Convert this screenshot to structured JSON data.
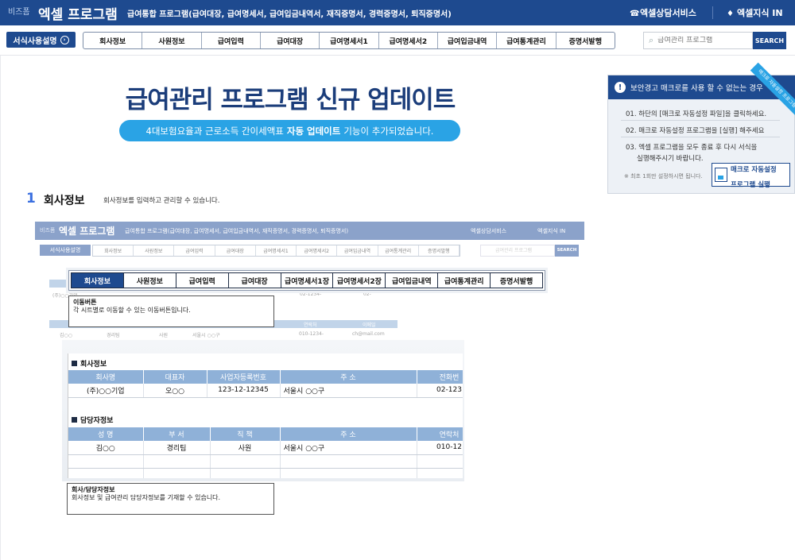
{
  "header": {
    "brand_small": "비즈폼",
    "brand_name": "엑셀 프로그램",
    "subtitle": "급여통합 프로그램(급여대장, 급여명세서, 급여입금내역서, 재직증명서, 경력증명서, 퇴직증명서)",
    "consult_link": "엑셀상담서비스",
    "knowledge_link": "엑셀지식 IN"
  },
  "nav": {
    "guide_button": "서식사용설명",
    "tabs": [
      "회사정보",
      "사원정보",
      "급여입력",
      "급여대장",
      "급여명세서1",
      "급여명세서2",
      "급여입금내역",
      "급여통계관리",
      "증명서발행"
    ],
    "search_placeholder": "급여관리 프로그램",
    "search_button": "SEARCH"
  },
  "banner": {
    "title": "급여관리 프로그램 신규 업데이트",
    "pill_prefix": "4대보험요율과 근로소득 간이세액표",
    "pill_bold": "자동 업데이트",
    "pill_suffix": "기능이 추가되었습니다."
  },
  "warning": {
    "title": "보안경고 매크로를 사용 할 수 없는는 경우",
    "ribbon": "매크로 자동설정 프로그램",
    "steps": [
      "01. 하단의 [매크로 자동설정 파일]을 클릭하세요.",
      "02. 매크로 자동설정 프로그램을 [실행] 해주세요",
      "03. 엑셀 프로그램을 모두 종료 후 다시 서식을",
      "실행해주시기 바랍니다."
    ],
    "note": "※ 최초 1회만 설정하시면 됩니다.",
    "macro_button_line1": "매크로 자동설정",
    "macro_button_line2": "프로그램 실행"
  },
  "section": {
    "number": "1",
    "title": "회사정보",
    "description": "회사정보를 입력하고 관리할 수 있습니다."
  },
  "mock": {
    "brand_small": "비즈폼",
    "brand_name": "엑셀 프로그램",
    "subtitle": "급여통합 프로그램(급여대장, 급여명세서, 급여입금내역서, 재직증명서, 경력증명서, 퇴직증명서)",
    "consult": "엑셀상담서비스",
    "knowledge": "엑셀지식 IN",
    "guide": "서식사용설명",
    "tabs": [
      "회사정보",
      "사원정보",
      "급여입력",
      "급여대장",
      "급여명세서1",
      "급여명세서2",
      "급여입금내역",
      "급여통계관리",
      "증명서발행"
    ],
    "search": "급여관리 프로그램",
    "search_btn": "SEARCH",
    "row_company": "(주)○○기업",
    "row_phone": "02-1234-",
    "row_phone2": "02-",
    "row_name": "김○○",
    "row_dept": "경리팀",
    "row_pos": "사원",
    "row_addr": "서울시 ○○구",
    "row_contact": "010-1234-",
    "row_email": "ch@mail.com",
    "hdr_contact": "연락처",
    "hdr_email": "이메일"
  },
  "callout_tabs": {
    "tabs": [
      "회사정보",
      "사원정보",
      "급여입력",
      "급여대장",
      "급여명세서1장",
      "급여명세서2장",
      "급여입금내역",
      "급여통계관리",
      "증명서발행"
    ],
    "tip_title": "이동버튼",
    "tip_text": "각 시트별로 이동할 수 있는 이동버튼입니다."
  },
  "company_table": {
    "heading": "회사정보",
    "columns": [
      "회사명",
      "대표자",
      "사업자등록번호",
      "주  소",
      "전화번"
    ],
    "row": [
      "(주)○○기업",
      "오○○",
      "123-12-12345",
      "서울시 ○○구",
      "02-123"
    ]
  },
  "contact_table": {
    "heading": "담당자정보",
    "columns": [
      "성  명",
      "부  서",
      "직  책",
      "주  소",
      "연락처"
    ],
    "row": [
      "김○○",
      "경리팀",
      "사원",
      "서울시 ○○구",
      "010-12"
    ]
  },
  "tip_table": {
    "title": "회사/담당자정보",
    "text": "회사정보 및 급여관리 담당자정보를 기재할 수 있습니다."
  }
}
